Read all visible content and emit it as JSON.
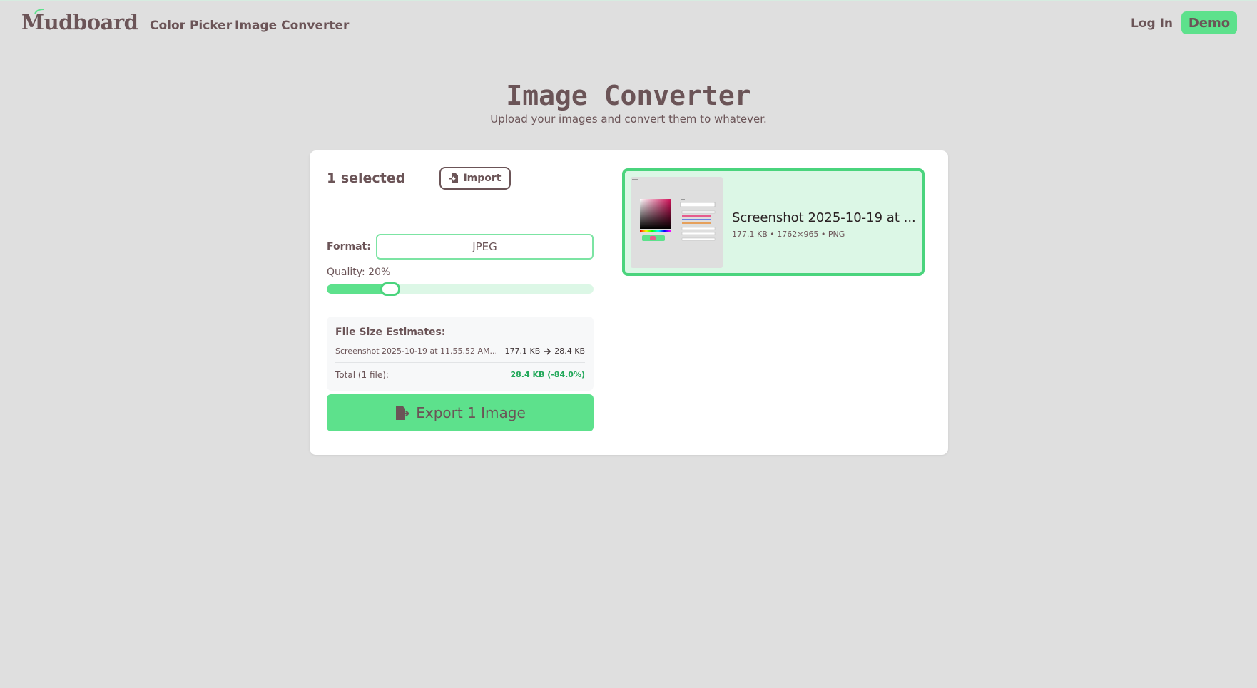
{
  "nav": {
    "logo_text": "Mudboard",
    "links": [
      "Color Picker",
      "Image Converter"
    ],
    "login_label": "Log In",
    "demo_label": "Demo"
  },
  "header": {
    "title": "Image Converter",
    "subtitle": "Upload your images and convert them to whatever."
  },
  "panel": {
    "selected_count": "1 selected",
    "import_label": "Import",
    "format_label": "Format:",
    "format_value": "JPEG",
    "quality_label": "Quality: 20%",
    "quality_value": 20
  },
  "estimates": {
    "title": "File Size Estimates:",
    "file_name": "Screenshot 2025-10-19 at 11.55.52 AM....",
    "original_size": "177.1 KB",
    "new_size": "28.4 KB",
    "total_label": "Total (1 file):",
    "total_value": "28.4 KB (-84.0%)"
  },
  "export_label": "Export 1 Image",
  "files": [
    {
      "name": "Screenshot 2025-10-19 at ...",
      "meta": "177.1 KB • 1762×965 • PNG"
    }
  ],
  "colors": {
    "accent": "#5de18c",
    "accent_border": "#4ad47d",
    "accent_light": "#dcf7e6",
    "text": "#6b5457",
    "background": "#dfdfdf"
  },
  "icons": [
    "sprout-icon",
    "import-icon",
    "arrow-right-icon",
    "export-icon"
  ]
}
